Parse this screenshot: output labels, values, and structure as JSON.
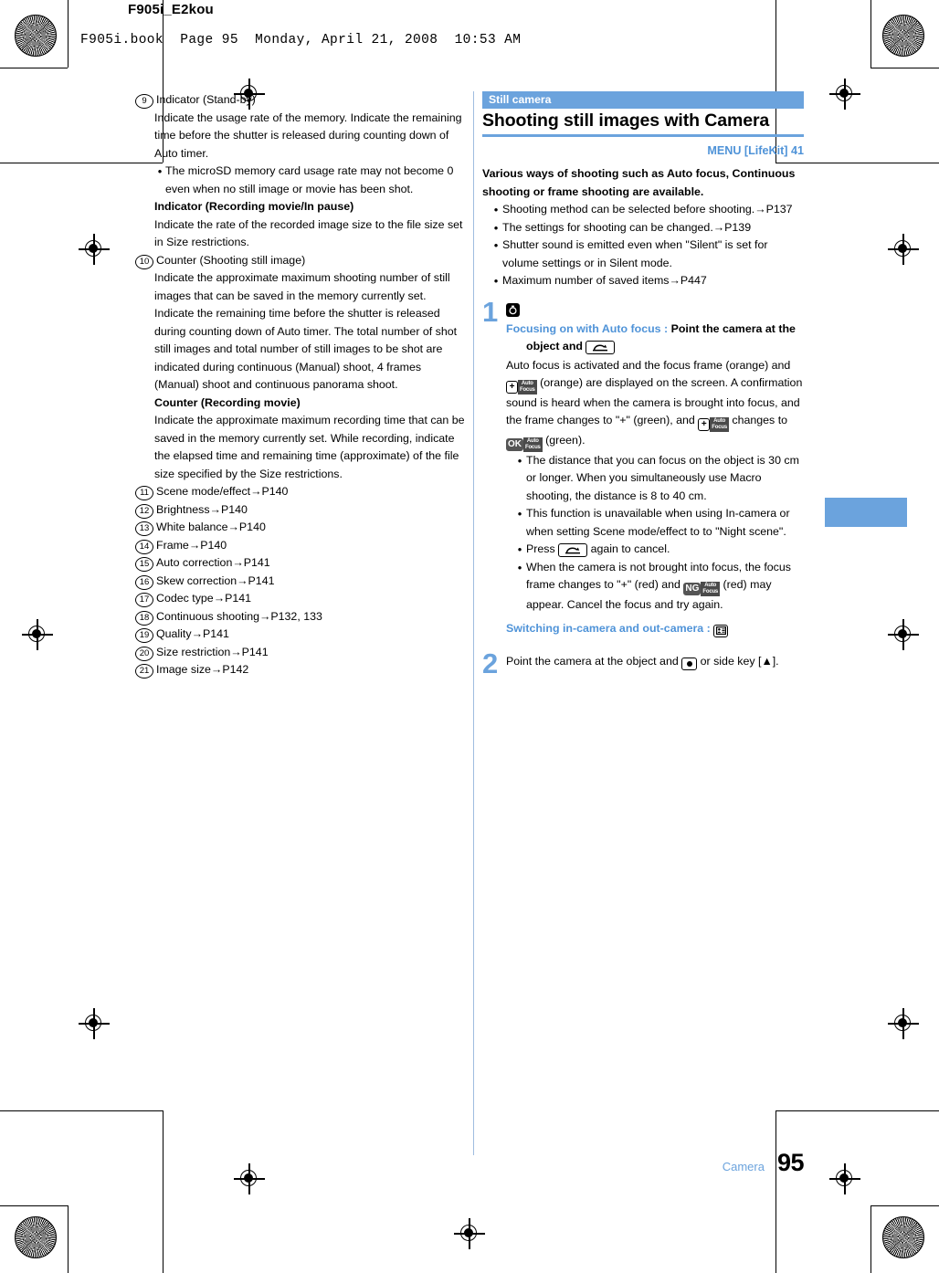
{
  "page_header": {
    "doc_tag": "F905i_E2kou",
    "book_line": "F905i.book  Page 95  Monday, April 21, 2008  10:53 AM"
  },
  "colors": {
    "accent_blue": "#6ba3dd",
    "link_blue": "#4f93d8",
    "text": "#000000"
  },
  "left_column": {
    "items": [
      {
        "num": "9",
        "title": "Indicator (Stand-by)",
        "paragraphs": [
          "Indicate the usage rate of the memory. Indicate the remaining time before the shutter is released during counting down of Auto timer."
        ],
        "bullets": [
          "The microSD memory card usage rate may not become 0 even when no still image or movie has been shot."
        ],
        "subtitle": "Indicator (Recording movie/In pause)",
        "subparagraphs": [
          "Indicate the rate of the recorded image size to the file size set in Size restrictions."
        ]
      },
      {
        "num": "10",
        "title": "Counter (Shooting still image)",
        "paragraphs": [
          "Indicate the approximate maximum shooting number of still images that can be saved in the memory currently set. Indicate the remaining time before the shutter is released during counting down of Auto timer. The total number of shot still images and total number of still images to be shot are indicated during continuous (Manual) shoot, 4 frames (Manual) shoot and continuous panorama shoot."
        ],
        "bullets": [],
        "subtitle": "Counter (Recording movie)",
        "subparagraphs": [
          "Indicate the approximate maximum recording time that can be saved in the memory currently set. While recording, indicate the elapsed time and remaining time (approximate) of the file size specified by the Size restrictions."
        ]
      }
    ],
    "reference_items": [
      {
        "num": "11",
        "label": "Scene mode/effect",
        "arrow": "→",
        "page": "P140"
      },
      {
        "num": "12",
        "label": "Brightness",
        "arrow": "→",
        "page": "P140"
      },
      {
        "num": "13",
        "label": "White balance",
        "arrow": "→",
        "page": "P140"
      },
      {
        "num": "14",
        "label": "Frame",
        "arrow": "→",
        "page": "P140"
      },
      {
        "num": "15",
        "label": "Auto correction",
        "arrow": "→",
        "page": "P141"
      },
      {
        "num": "16",
        "label": "Skew correction",
        "arrow": "→",
        "page": "P141"
      },
      {
        "num": "17",
        "label": "Codec type",
        "arrow": "→",
        "page": "P141"
      },
      {
        "num": "18",
        "label": "Continuous shooting",
        "arrow": "→",
        "page": "P132, 133"
      },
      {
        "num": "19",
        "label": "Quality",
        "arrow": "→",
        "page": "P141"
      },
      {
        "num": "20",
        "label": "Size restriction",
        "arrow": "→",
        "page": "P141"
      },
      {
        "num": "21",
        "label": "Image size",
        "arrow": "→",
        "page": "P142"
      }
    ]
  },
  "right_column": {
    "section_tag": "Still camera",
    "section_title": "Shooting still images with Camera",
    "menu_line": "MENU [LifeKit] 41",
    "lead": "Various ways of shooting such as Auto focus, Continuous shooting or frame shooting are available.",
    "lead_bullets": [
      "Shooting method can be selected before shooting.→P137",
      "The settings for shooting can be changed.→P139",
      "Shutter sound is emitted even when \"Silent\" is set for volume settings or in Silent mode.",
      "Maximum number of saved items→P447"
    ],
    "steps": [
      {
        "num": "1",
        "icon": "timer-icon",
        "heading_blue": "Focusing on with Auto focus :",
        "heading_bold_a": "Point the camera at the object and",
        "body_1a": "Auto focus is activated and the focus frame (orange) and",
        "body_1b": "(orange) are displayed on the screen. A confirmation sound is heard when the camera is brought into focus, and the frame changes to \"+\" (green), and",
        "body_1c": "changes to",
        "body_1d": "(green).",
        "bullets": [
          "The distance that you can focus on the object is 30 cm or longer. When you simultaneously use Macro shooting, the distance is 8 to 40 cm.",
          "This function is unavailable when using In-camera or when setting Scene mode/effect to to \"Night scene\".",
          "Press _KEY_ again to cancel.",
          "When the camera is not brought into focus, the focus frame changes to \"+\" (red) and _NG_ (red) may appear. Cancel the focus and try again."
        ],
        "press_bullet_pre": "Press",
        "press_bullet_post": "again to cancel.",
        "ng_bullet_pre": "When the camera is not brought into focus, the focus frame changes to \"+\" (red) and",
        "ng_bullet_post": "(red) may appear. Cancel the focus and try again.",
        "switch_line": "Switching in-camera and out-camera :"
      },
      {
        "num": "2",
        "text_a": "Point the camera at the object and",
        "text_b": "or side key [▲]."
      }
    ],
    "icon_labels": {
      "af_top": "Auto",
      "af_bottom": "Focus",
      "plus": "+",
      "ok": "OK",
      "ng": "NG"
    }
  },
  "footer": {
    "label": "Camera",
    "page_number": "95"
  }
}
